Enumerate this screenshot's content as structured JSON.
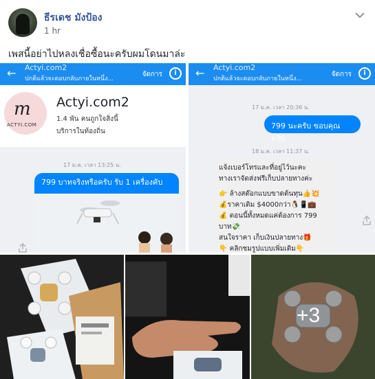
{
  "post": {
    "author": "ธีรเดช มังป้อง",
    "time": "1 hr",
    "text": "เพสนี้อย่าไปหลงเชื่อซื้อนะครับผมโดนมาล่ะ"
  },
  "left_screenshot": {
    "header_title": "Actyi.com2",
    "header_subtitle": "ปกติแล้วจะตอบกลับภายในหนึ่ง...",
    "manage_label": "จัดการ",
    "page_name": "Actyi.com2",
    "page_likes": "1.4 พัน คนถูกใจสิ่งนี้",
    "page_category": "บริการในท้องถิ่น",
    "logo_text": "ACTYI.COM",
    "timestamp": "17 ม.ค. เวลา 13:25 น.",
    "message": "799 บาทจริงหรือครับ รับ 1 เครื่องคับ"
  },
  "right_screenshot": {
    "header_title": "Actyi.com2",
    "header_subtitle": "ปกติแล้วจะตอบกลับภายในหนึ่ง...",
    "manage_label": "จัดการ",
    "timestamp1": "17 ม.ค. เวลา 20:36 น.",
    "message1": "799 นะครับ ขอบคุณครับ",
    "timestamp2": "18 ม.ค. เวลา 11:37 น.",
    "reply_lines": [
      "แจ้งเบอร์โทรและที่อยู่ไว้นะคะ",
      "ทางเราจัดส่งฟรีเก็บปลายทางค่ะ",
      "👉 ล้างสต๊อกแบบขาดต้นทุน👍💥",
      "💰ราคาเดิม $4000กว่า🐧📱💼",
      "💰 ตอนนี้ทั้งหมดแค่ต้องการ 799",
      "บาท💸",
      "สนใจราคา เก็บเงินปลายทาง🎁",
      "👇 คลิกชมรูปแบบเพิ่มเติม👇"
    ]
  },
  "photos": {
    "more_count": "+3"
  },
  "colors": {
    "fb_link": "#365899",
    "messenger_blue": "#1c8df0",
    "bubble_blue": "#0084ff"
  }
}
